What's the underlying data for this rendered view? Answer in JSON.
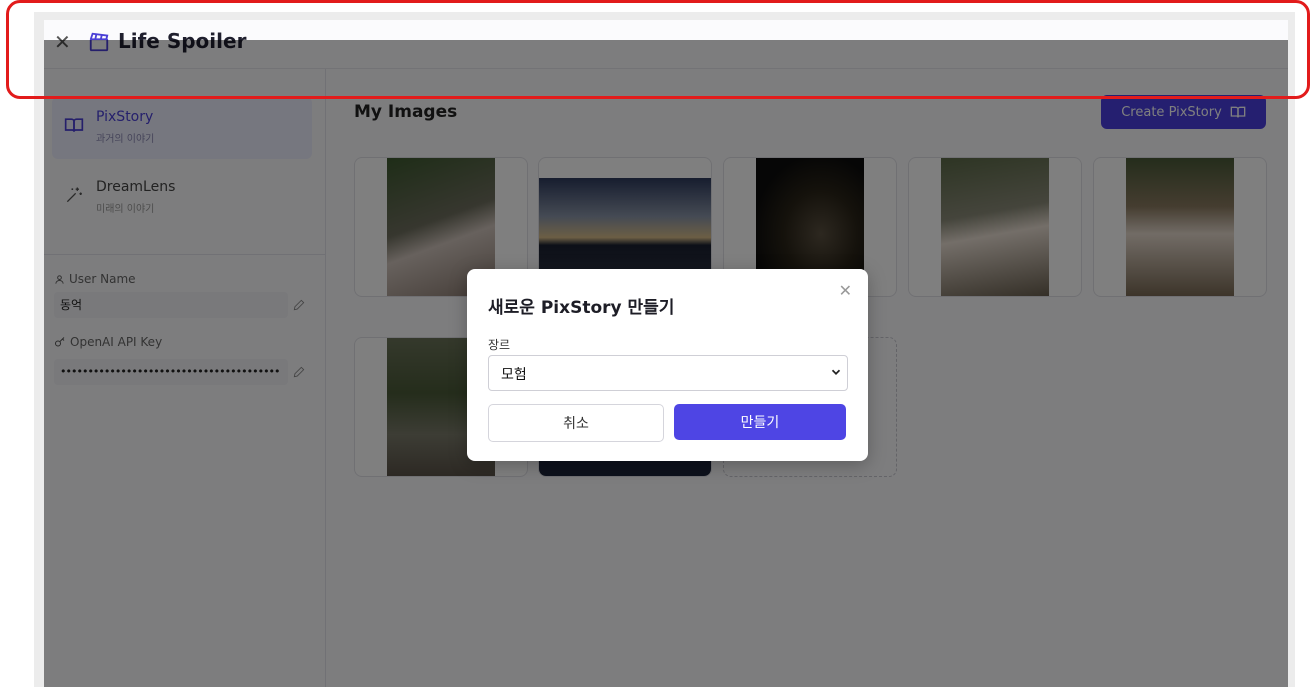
{
  "app": {
    "title": "Life Spoiler",
    "close_icon": "close-icon",
    "logo_icon": "clapperboard-icon"
  },
  "sidebar": {
    "items": [
      {
        "label": "PixStory",
        "subtitle": "과거의 이야기",
        "icon": "book-icon",
        "active": true
      },
      {
        "label": "DreamLens",
        "subtitle": "미래의 이야기",
        "icon": "magic-wand-icon",
        "active": false
      }
    ],
    "user_name": {
      "label": "User Name",
      "value": "동억",
      "icon": "user-icon"
    },
    "api_key": {
      "label": "OpenAI API Key",
      "value": "••••••••••••••••••••••••••••••••••••••••",
      "icon": "key-icon"
    }
  },
  "main": {
    "section_title": "My Images",
    "create_button": "Create PixStory",
    "images": [
      {
        "alt": "white dog on leash near plants",
        "colors": [
          "#3d5a2f",
          "#6e6e5e",
          "#b8a29a"
        ]
      },
      {
        "alt": "sunset sky over city skyline",
        "colors": [
          "#3a4a6a",
          "#d1b98b",
          "#1c2230"
        ]
      },
      {
        "alt": "shadow of dog at night",
        "colors": [
          "#101010",
          "#4a4030",
          "#6d6250"
        ]
      },
      {
        "alt": "pomeranian on boardwalk",
        "colors": [
          "#5c6a48",
          "#9a8a7a",
          "#e8ddd2"
        ]
      },
      {
        "alt": "pomeranian on dirt ground",
        "colors": [
          "#8a7a60",
          "#5a6040",
          "#e4d8cc"
        ]
      },
      {
        "alt": "dog on boardwalk path in grass",
        "colors": [
          "#4a5a38",
          "#7a7a6a",
          "#cfc8b8"
        ]
      },
      {
        "alt": "dark image",
        "colors": [
          "#1a2238",
          "#1f2a44",
          "#0e1220"
        ]
      }
    ]
  },
  "modal": {
    "title": "새로운 PixStory 만들기",
    "genre_label": "장르",
    "genre_value": "모험",
    "cancel_label": "취소",
    "create_label": "만들기"
  }
}
